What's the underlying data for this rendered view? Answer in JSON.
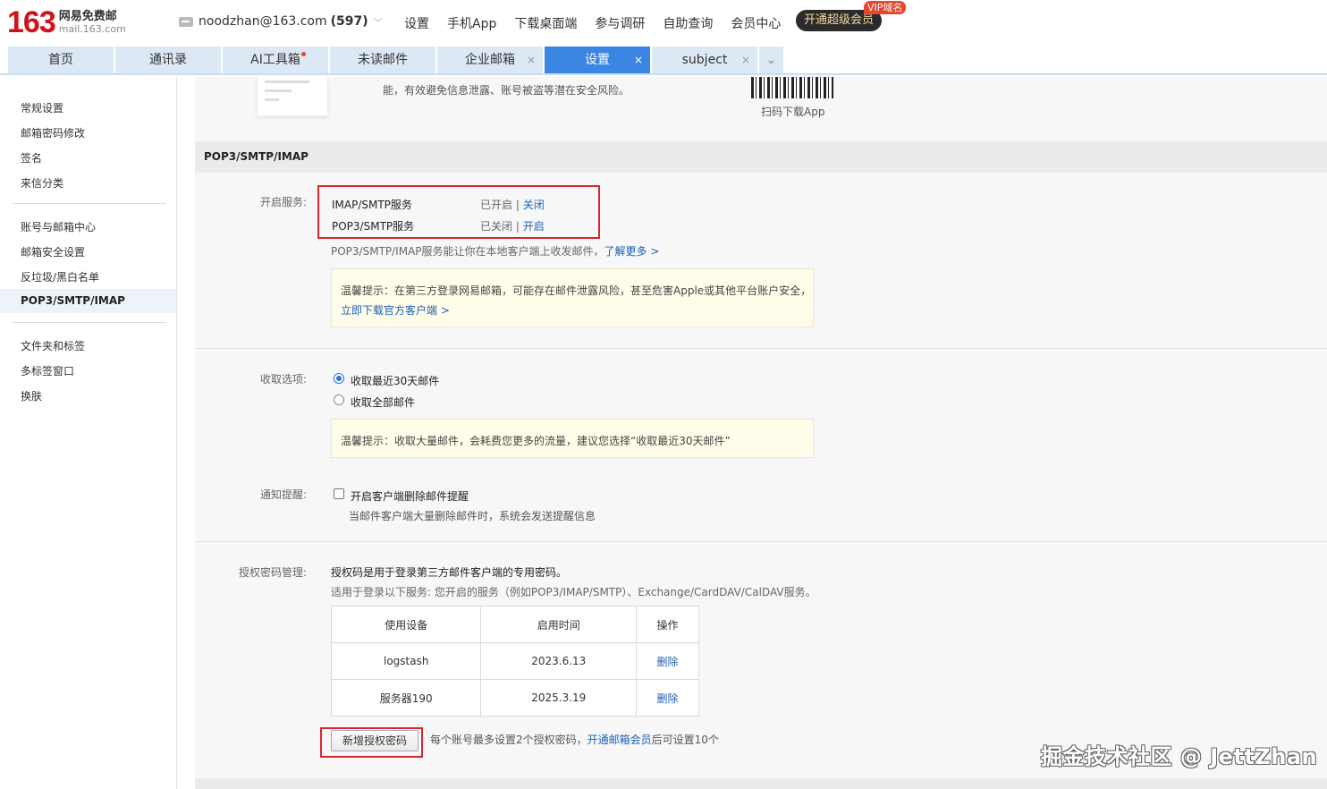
{
  "header": {
    "logo_number": "163",
    "logo_cn": "网易免费邮",
    "logo_en": "mail.163.com",
    "email": "noodzhan@163.com",
    "unread_count": "(597)",
    "nav": [
      "设置",
      "手机App",
      "下载桌面端",
      "参与调研",
      "自助查询",
      "会员中心"
    ],
    "vip_button": "开通超级会员",
    "vip_tag": "VIP域名"
  },
  "tabs": [
    {
      "label": "首页"
    },
    {
      "label": "通讯录"
    },
    {
      "label": "AI工具箱"
    },
    {
      "label": "未读邮件"
    },
    {
      "label": "企业邮箱",
      "close": "×"
    },
    {
      "label": "设置",
      "close": "×"
    },
    {
      "label": "subject",
      "close": "×"
    },
    {
      "label": "⌄"
    }
  ],
  "sidebar": {
    "group1": [
      "常规设置",
      "邮箱密码修改",
      "签名",
      "来信分类"
    ],
    "group2": [
      "账号与邮箱中心",
      "邮箱安全设置",
      "反垃圾/黑白名单",
      "POP3/SMTP/IMAP"
    ],
    "group3": [
      "文件夹和标签",
      "多标签窗口",
      "换肤"
    ]
  },
  "promo": {
    "text": "能，有效避免信息泄露、账号被盗等潜在安全风险。",
    "qr_label": "扫码下载App"
  },
  "section_title": "POP3/SMTP/IMAP",
  "services": {
    "label": "开启服务:",
    "rows": [
      {
        "name": "IMAP/SMTP服务",
        "status": "已开启",
        "sep": "|",
        "action": "关闭"
      },
      {
        "name": "POP3/SMTP服务",
        "status": "已关闭",
        "sep": "|",
        "action": "开启"
      }
    ],
    "desc": "POP3/SMTP/IMAP服务能让你在本地客户端上收发邮件，",
    "learn_more": "了解更多 >",
    "tip_line1": "温馨提示：在第三方登录网易邮箱，可能存在邮件泄露风险，甚至危害Apple或其他平台账户安全，",
    "tip_link": "立即下载官方客户端 >"
  },
  "receive": {
    "label": "收取选项:",
    "options": [
      "收取最近30天邮件",
      "收取全部邮件"
    ],
    "selected": "收取最近30天邮件",
    "tip": "温馨提示：收取大量邮件，会耗费您更多的流量，建议您选择“收取最近30天邮件”"
  },
  "notify": {
    "label": "通知提醒:",
    "checkbox_label": "开启客户端删除邮件提醒",
    "checked": false,
    "desc": "当邮件客户端大量删除邮件时，系统会发送提醒信息"
  },
  "auth": {
    "label": "授权密码管理:",
    "line1": "授权码是用于登录第三方邮件客户端的专用密码。",
    "line2": "适用于登录以下服务: 您开启的服务（例如POP3/IMAP/SMTP）、Exchange/CardDAV/CalDAV服务。",
    "columns": [
      "使用设备",
      "启用时间",
      "操作"
    ],
    "rows": [
      {
        "device": "logstash",
        "date": "2023.6.13",
        "action": "删除"
      },
      {
        "device": "服务器190",
        "date": "2025.3.19",
        "action": "删除"
      }
    ],
    "add_button": "新增授权密码",
    "note_pre": "每个账号最多设置2个授权密码，",
    "note_link": "开通邮箱会员",
    "note_post": "后可设置10个"
  },
  "watermark": "掘金技术社区 @ JettZhan",
  "colors": {
    "brand_red": "#d0121b",
    "tab_active": "#3b86e3",
    "link": "#1d5fb8",
    "highlight_box": "#d9262e"
  }
}
